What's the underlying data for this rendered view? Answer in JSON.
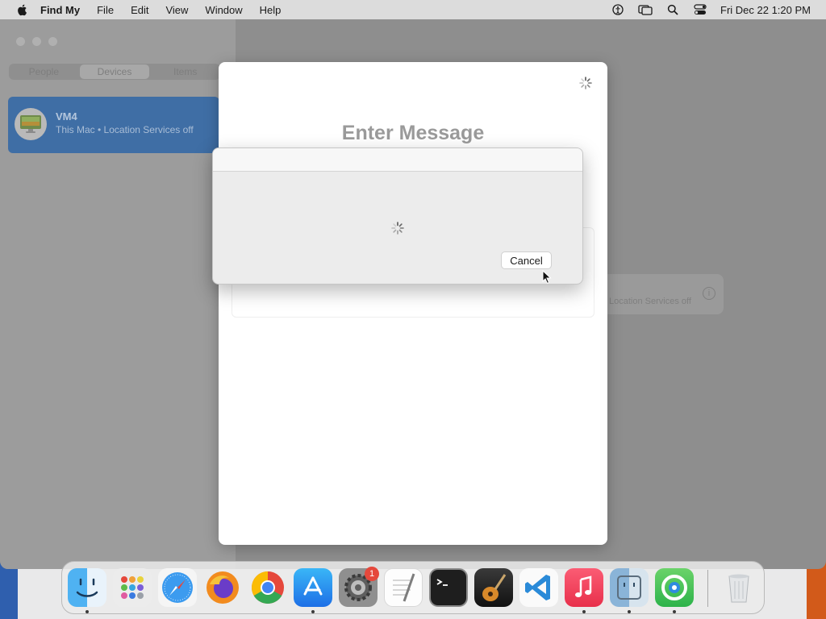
{
  "menubar": {
    "app_name": "Find My",
    "menus": [
      "File",
      "Edit",
      "View",
      "Window",
      "Help"
    ],
    "status_icons": [
      "accessibility-icon",
      "screen-mirroring-icon",
      "spotlight-search-icon",
      "control-center-icon"
    ],
    "clock": "Fri Dec 22  1:20 PM"
  },
  "sidebar": {
    "segments": [
      "People",
      "Devices",
      "Items"
    ],
    "active_segment": "Devices",
    "device": {
      "name": "VM4",
      "subtitle": "This Mac • Location Services off"
    }
  },
  "background_card": {
    "text": "Location Services off"
  },
  "sheet": {
    "title": "Enter Message"
  },
  "dialog": {
    "cancel_label": "Cancel"
  },
  "dock": {
    "apps": [
      "Finder",
      "Launchpad",
      "Safari",
      "Firefox",
      "Chrome",
      "App Store",
      "System Settings",
      "TextEdit",
      "Terminal",
      "GarageBand",
      "VS Code",
      "Music",
      "Preview",
      "Find My",
      "Trash"
    ],
    "system_settings_badge": "1"
  },
  "colors": {
    "accent_selection": "#3f6ea5",
    "badge_red": "#e5483c"
  }
}
